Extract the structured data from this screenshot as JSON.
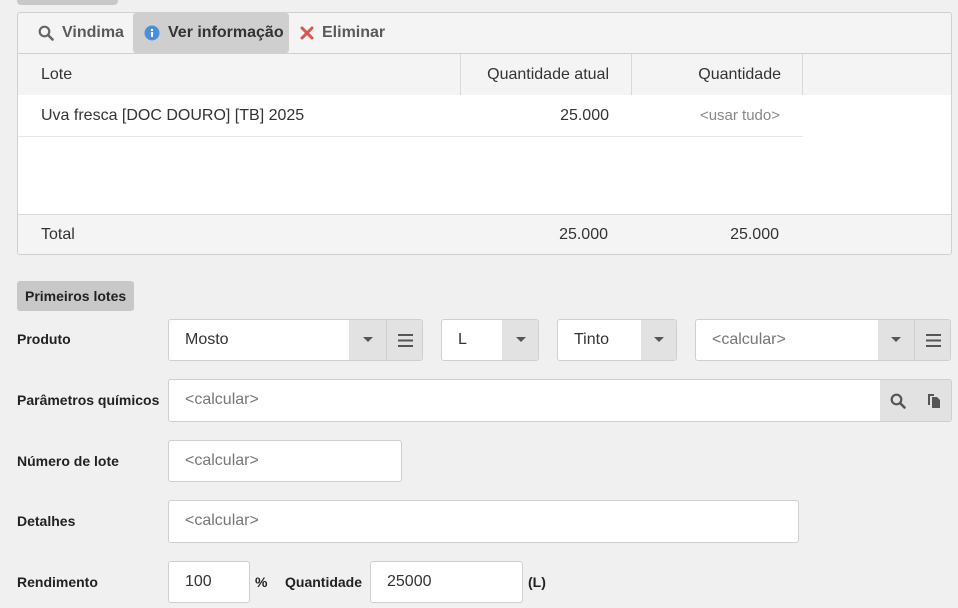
{
  "toolbar": {
    "vindima_label": "Vindima",
    "ver_label": "Ver informação",
    "eliminar_label": "Eliminar"
  },
  "table": {
    "headers": [
      "Lote",
      "Quantidade atual",
      "Quantidade"
    ],
    "rows": [
      {
        "lote": "Uva fresca [DOC DOURO] [TB] 2025",
        "quantidade_atual": "25.000",
        "quantidade": "<usar tudo>"
      }
    ],
    "footer": {
      "label": "Total",
      "quantidade_atual": "25.000",
      "quantidade": "25.000"
    }
  },
  "section_title": "Primeiros lotes",
  "form": {
    "produto": {
      "label": "Produto",
      "product_value": "Mosto",
      "unit_value": "L",
      "color_value": "Tinto",
      "extra_placeholder": "<calcular>"
    },
    "parametros": {
      "label": "Parâmetros químicos",
      "placeholder": "<calcular>"
    },
    "numero_lote": {
      "label": "Número de lote",
      "placeholder": "<calcular>"
    },
    "detalhes": {
      "label": "Detalhes",
      "placeholder": "<calcular>"
    },
    "rendimento": {
      "label": "Rendimento",
      "value": "100",
      "unit": "%",
      "quantidade_label": "Quantidade",
      "quantidade_value": "25000",
      "quantidade_unit": "(L)"
    }
  },
  "colors": {
    "info_icon": "#4a90d9",
    "delete_icon": "#d9534f",
    "addon_bg": "#e2e2e2"
  }
}
